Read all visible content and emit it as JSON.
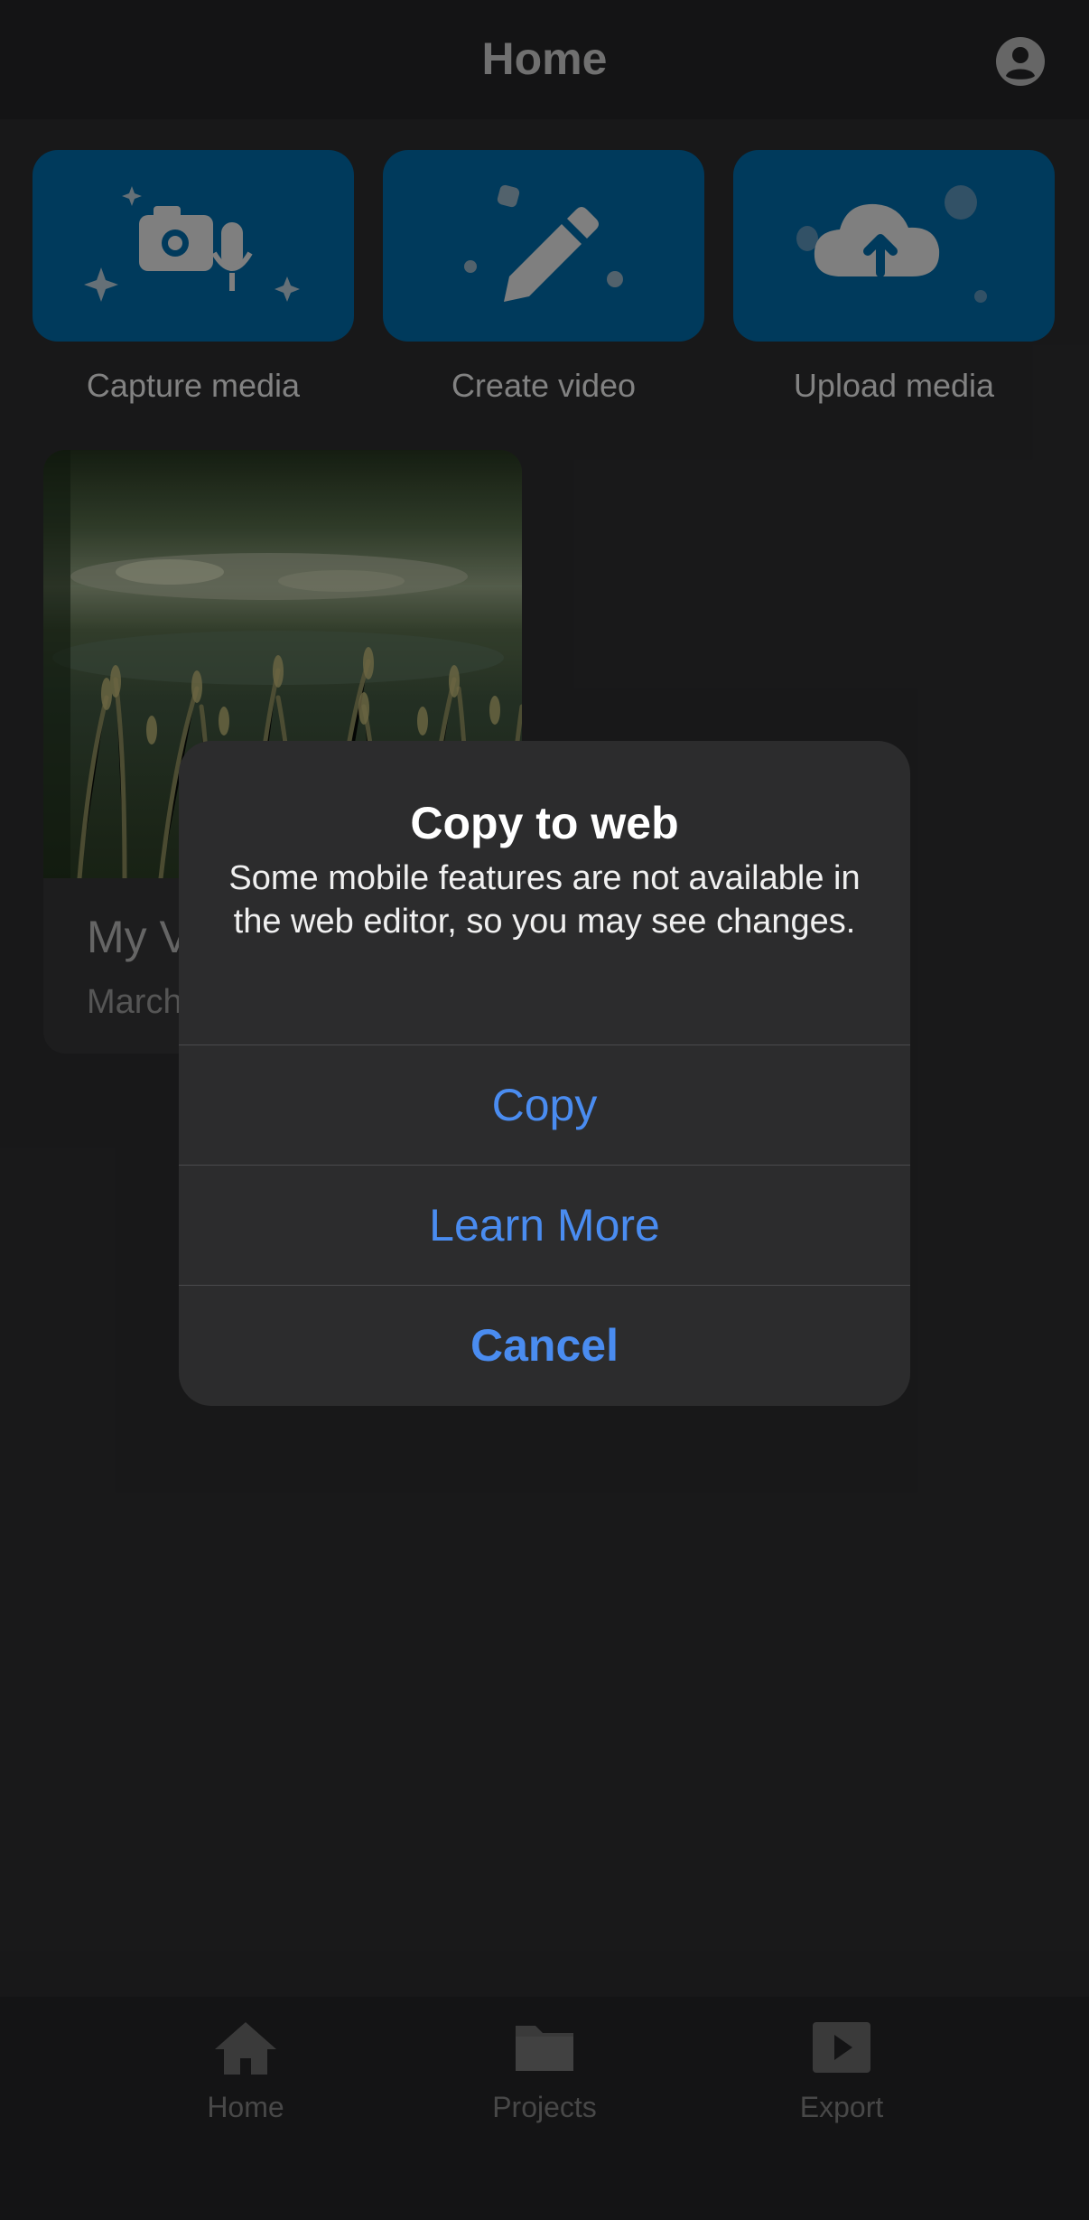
{
  "header": {
    "title": "Home"
  },
  "actions": [
    {
      "label": "Capture media",
      "icon": "camera-mic-icon"
    },
    {
      "label": "Create video",
      "icon": "pencil-icon"
    },
    {
      "label": "Upload media",
      "icon": "cloud-upload-icon"
    }
  ],
  "project": {
    "title": "My V",
    "date": "March"
  },
  "nav": {
    "items": [
      {
        "label": "Home",
        "icon": "home-icon"
      },
      {
        "label": "Projects",
        "icon": "folder-icon"
      },
      {
        "label": "Export",
        "icon": "play-icon"
      }
    ]
  },
  "dialog": {
    "title": "Copy to web",
    "message": "Some mobile features are not available in the web editor, so you may see changes.",
    "buttons": {
      "copy": "Copy",
      "learn_more": "Learn More",
      "cancel": "Cancel"
    }
  },
  "colors": {
    "accent": "#4a8cf0",
    "tile_bg": "#003f64",
    "background": "#1b1b1c"
  }
}
